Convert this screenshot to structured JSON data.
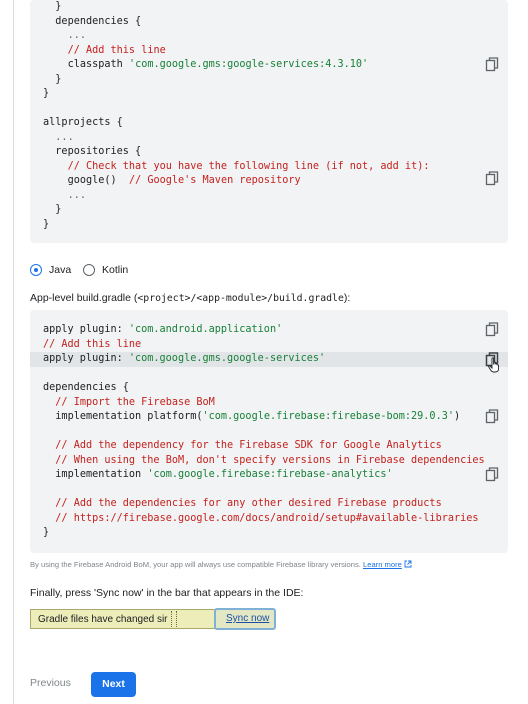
{
  "project_code": [
    {
      "indent": 1,
      "parts": [
        [
          "kw",
          "}"
        ]
      ]
    },
    {
      "indent": 1,
      "parts": [
        [
          "kw",
          "dependencies {"
        ]
      ]
    },
    {
      "indent": 2,
      "parts": [
        [
          "dots",
          "..."
        ]
      ]
    },
    {
      "indent": 2,
      "parts": [
        [
          "cm",
          "// Add this line"
        ]
      ]
    },
    {
      "indent": 2,
      "parts": [
        [
          "kw",
          "classpath "
        ],
        [
          "str",
          "'com.google.gms:google-services:4.3.10'"
        ]
      ]
    },
    {
      "indent": 1,
      "parts": [
        [
          "kw",
          "}"
        ]
      ]
    },
    {
      "indent": 0,
      "parts": [
        [
          "kw",
          "}"
        ]
      ]
    },
    {
      "indent": 0,
      "parts": [
        [
          "kw",
          ""
        ]
      ]
    },
    {
      "indent": 0,
      "parts": [
        [
          "kw",
          "allprojects {"
        ]
      ]
    },
    {
      "indent": 1,
      "parts": [
        [
          "dots",
          "..."
        ]
      ]
    },
    {
      "indent": 1,
      "parts": [
        [
          "kw",
          "repositories {"
        ]
      ]
    },
    {
      "indent": 2,
      "parts": [
        [
          "cm",
          "// Check that you have the following line (if not, add it):"
        ]
      ]
    },
    {
      "indent": 2,
      "parts": [
        [
          "kw",
          "google()  "
        ],
        [
          "cm",
          "// Google's Maven repository"
        ]
      ]
    },
    {
      "indent": 2,
      "parts": [
        [
          "dots",
          "..."
        ]
      ]
    },
    {
      "indent": 1,
      "parts": [
        [
          "kw",
          "}"
        ]
      ]
    },
    {
      "indent": 0,
      "parts": [
        [
          "kw",
          "}"
        ]
      ]
    }
  ],
  "radios": {
    "java": "Java",
    "kotlin": "Kotlin",
    "selected": "java"
  },
  "app_heading": {
    "prefix": "App-level build.gradle (",
    "path": "<project>/<app-module>/build.gradle",
    "suffix": "):"
  },
  "app_code": [
    {
      "indent": 0,
      "parts": [
        [
          "kw",
          "apply plugin: "
        ],
        [
          "str",
          "'com.android.application'"
        ]
      ]
    },
    {
      "indent": 0,
      "parts": [
        [
          "cm",
          "// Add this line"
        ]
      ]
    },
    {
      "indent": 0,
      "parts": [
        [
          "kw",
          "apply plugin: "
        ],
        [
          "str",
          "'com.google.gms.google-services'"
        ]
      ]
    },
    {
      "indent": 0,
      "parts": [
        [
          "kw",
          ""
        ]
      ]
    },
    {
      "indent": 0,
      "parts": [
        [
          "kw",
          "dependencies {"
        ]
      ]
    },
    {
      "indent": 1,
      "parts": [
        [
          "cm",
          "// Import the Firebase BoM"
        ]
      ]
    },
    {
      "indent": 1,
      "parts": [
        [
          "kw",
          "implementation platform("
        ],
        [
          "str",
          "'com.google.firebase:firebase-bom:29.0.3'"
        ],
        [
          "kw",
          ")"
        ]
      ]
    },
    {
      "indent": 0,
      "parts": [
        [
          "kw",
          ""
        ]
      ]
    },
    {
      "indent": 1,
      "parts": [
        [
          "cm",
          "// Add the dependency for the Firebase SDK for Google Analytics"
        ]
      ]
    },
    {
      "indent": 1,
      "parts": [
        [
          "cm",
          "// When using the BoM, don't specify versions in Firebase dependencies"
        ]
      ]
    },
    {
      "indent": 1,
      "parts": [
        [
          "kw",
          "implementation "
        ],
        [
          "str",
          "'com.google.firebase:firebase-analytics'"
        ]
      ]
    },
    {
      "indent": 0,
      "parts": [
        [
          "kw",
          ""
        ]
      ]
    },
    {
      "indent": 1,
      "parts": [
        [
          "cm",
          "// Add the dependencies for any other desired Firebase products"
        ]
      ]
    },
    {
      "indent": 1,
      "parts": [
        [
          "cm",
          "// https://firebase.google.com/docs/android/setup#available-libraries"
        ]
      ]
    },
    {
      "indent": 0,
      "parts": [
        [
          "kw",
          "}"
        ]
      ]
    }
  ],
  "bom_note": {
    "text": "By using the Firebase Android BoM, your app will always use compatible Firebase library versions. ",
    "link": "Learn more"
  },
  "finally_text": "Finally, press 'Sync now' in the bar that appears in the IDE:",
  "ide_bar": {
    "message": "Gradle files have changed sir",
    "sync": "Sync now"
  },
  "nav": {
    "previous": "Previous",
    "next": "Next"
  },
  "colors": {
    "accent": "#1a73e8",
    "code_bg": "#f1f3f4",
    "string": "#188038",
    "comment": "#c5221f"
  },
  "icons": {
    "copy": "copy-icon",
    "external": "external-link-icon"
  }
}
